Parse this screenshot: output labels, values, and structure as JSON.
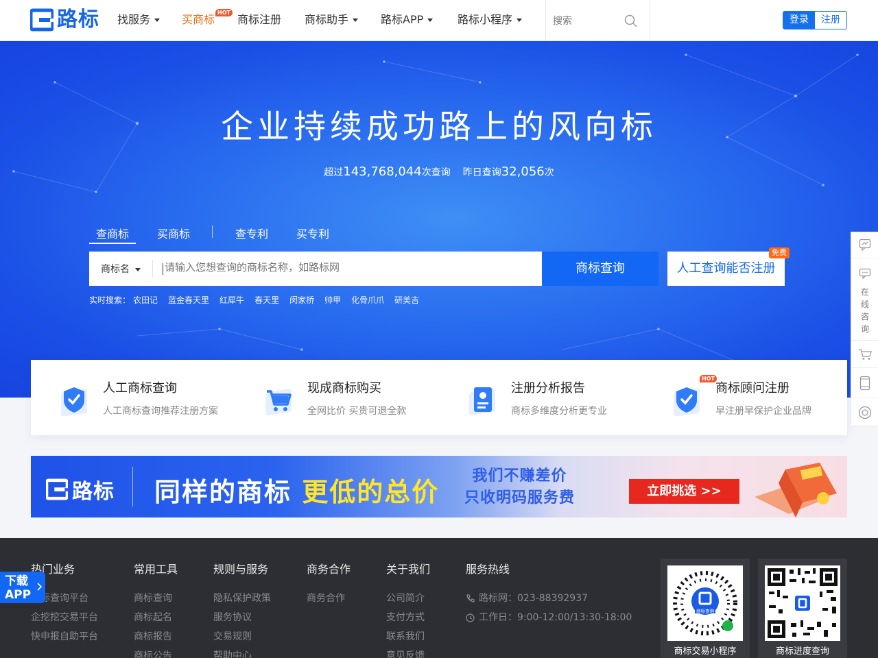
{
  "header": {
    "brand": "路标",
    "nav": [
      {
        "label": "找服务",
        "dropdown": true
      },
      {
        "label": "买商标",
        "dropdown": false,
        "active": true,
        "badge": "HOT"
      },
      {
        "label": "商标注册",
        "dropdown": false
      },
      {
        "label": "商标助手",
        "dropdown": true
      },
      {
        "label": "路标APP",
        "dropdown": true
      },
      {
        "label": "路标小程序",
        "dropdown": true
      }
    ],
    "search_placeholder": "搜索",
    "login_label": "登录",
    "register_label": "注册"
  },
  "hero": {
    "title": "企业持续成功路上的风向标",
    "stats": {
      "prefix": "超过",
      "total_queries": "143,768,044",
      "total_suffix": "次查询",
      "yesterday_prefix": "昨日查询",
      "yesterday_queries": "32,056",
      "yesterday_suffix": "次"
    },
    "tabs": [
      "查商标",
      "买商标",
      "查专利",
      "买专利"
    ],
    "search": {
      "type_label": "商标名",
      "placeholder": "请输入您想查询的商标名称，如路标网",
      "button_label": "商标查询",
      "manual_label": "人工查询能否注册",
      "free_badge": "免费"
    },
    "realtime": {
      "label": "实时搜索：",
      "keywords": [
        "农田记",
        "蓝金春天里",
        "红犀牛",
        "春天里",
        "闵家桥",
        "帅甲",
        "化骨爪爪",
        "研美吉"
      ]
    }
  },
  "features": [
    {
      "title": "人工商标查询",
      "desc": "人工商标查询推荐注册方案",
      "icon": "shield-check-icon"
    },
    {
      "title": "现成商标购买",
      "desc": "全网比价 买贵可退全款",
      "icon": "shopping-cart-icon"
    },
    {
      "title": "注册分析报告",
      "desc": "商标多维度分析更专业",
      "icon": "report-icon"
    },
    {
      "title": "商标顾问注册",
      "desc": "早注册早保护企业品牌",
      "icon": "shield-check-icon",
      "badge": "HOT"
    }
  ],
  "banner": {
    "brand": "路标",
    "slogan_part1": "同样的商标",
    "slogan_highlight": "更低的总价",
    "sub_line1": "我们不赚差价",
    "sub_line2": "只收明码服务费",
    "cta": "立即挑选 >>"
  },
  "footer": {
    "columns": [
      {
        "title": "热门业务",
        "links": [
          "商标查询平台",
          "企挖挖交易平台",
          "快申报自助平台"
        ]
      },
      {
        "title": "常用工具",
        "links": [
          "商标查询",
          "商标起名",
          "商标报告",
          "商标公告"
        ]
      },
      {
        "title": "规则与服务",
        "links": [
          "隐私保护政策",
          "服务协议",
          "交易规则",
          "帮助中心"
        ]
      },
      {
        "title": "商务合作",
        "links": [
          "商务合作"
        ]
      },
      {
        "title": "关于我们",
        "links": [
          "公司简介",
          "支付方式",
          "联系我们",
          "意见反馈"
        ]
      }
    ],
    "hotline": {
      "title": "服务热线",
      "phone": "路标网：023-88392937",
      "hours": "工作日：9:00-12:00/13:30-18:00"
    },
    "qrcodes": [
      {
        "label": "商标交易小程序",
        "center_text": "商标查询"
      },
      {
        "label": "商标进度查询"
      }
    ]
  },
  "sidebar": {
    "consult_label": "在线咨询"
  },
  "download_app": {
    "line1": "下载",
    "line2": "APP"
  },
  "colors": {
    "brand_blue": "#1268f5",
    "hot_orange": "#f06a0f",
    "cta_red": "#e8271e",
    "footer_bg": "#2d2e33"
  }
}
